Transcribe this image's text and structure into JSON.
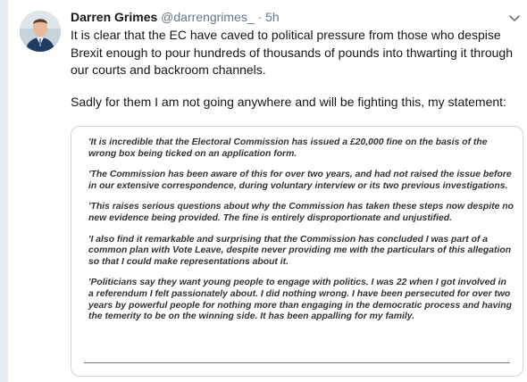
{
  "tweet": {
    "author_name": "Darren Grimes",
    "author_handle": "@darrengrimes_",
    "separator": "·",
    "timestamp": "5h",
    "paragraphs": [
      "It is clear that the EC have caved to political pressure from those who despise Brexit enough to pour hundreds of thousands of pounds into thwarting it through our courts and backroom channels.",
      "Sadly for them I am not going anywhere and will be fighting this, my statement:"
    ]
  },
  "statement_image": {
    "paragraphs": [
      "'It is incredible that the Electoral Commission has issued a £20,000 fine on the basis of the wrong box being ticked on an application form.",
      "'The Commission has been aware of this for over two years, and had not raised the issue before in our extensive correspondence, during voluntary interview or its two previous investigations.",
      "'This raises serious questions about why the Commission has taken these steps now despite no new evidence being provided. The fine is entirely disproportionate and unjustified.",
      "'I also find it remarkable and surprising that the Commission has concluded I was part of a common plan with Vote Leave, despite never providing me with the particulars of this allegation so that I could make representations about it.",
      "'Politicians say they want young people to engage with politics. I was 22 when I got involved in a referendum I felt passionately about. I did nothing wrong. I have been persecuted for over two years by powerful people for nothing more than engaging in the democratic process and having the temerity to be on the winning side. It has been appalling for my family."
    ]
  },
  "icons": {
    "avatar": "profile-photo",
    "menu": "chevron-down-icon"
  },
  "colors": {
    "text": "#14171a",
    "muted": "#657786",
    "border": "#ccd6dd",
    "sidebar": "#e6ecf0"
  }
}
